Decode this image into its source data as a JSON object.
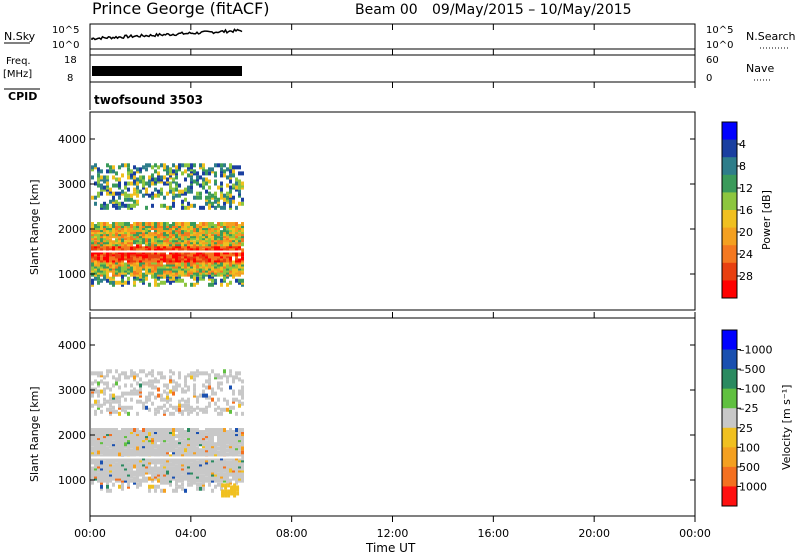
{
  "header": {
    "station": "Prince George (fitACF)",
    "beam": "Beam 00",
    "date_range": "09/May/2015 – 10/May/2015"
  },
  "nsky": {
    "label": "N.Sky",
    "tick_top": "10^5",
    "tick_bot": "10^0",
    "right_tick_top": "10^5",
    "right_tick_bot": "10^0",
    "right_label": "N.Search"
  },
  "freq": {
    "label_top": "Freq.",
    "label_bot": "[MHz]",
    "tick_top": "18",
    "tick_bot": "8",
    "right_tick_top": "60",
    "right_tick_bot": "0",
    "right_label": "Nave"
  },
  "cpid": {
    "label": "CPID",
    "value": "twofsound 3503"
  },
  "power_panel": {
    "ylabel": "Slant Range [km]",
    "yticks": [
      "1000",
      "2000",
      "3000",
      "4000"
    ],
    "colorbar_label": "Power [dB]",
    "colorbar_ticks": [
      "4",
      "8",
      "12",
      "16",
      "20",
      "24",
      "28"
    ],
    "colors": [
      "#0000ff",
      "#1a3fa0",
      "#2e7d8a",
      "#3a9a5a",
      "#8dc63f",
      "#f0c020",
      "#f4a020",
      "#f47820",
      "#e84010",
      "#ff0000"
    ]
  },
  "velocity_panel": {
    "ylabel": "Slant Range [km]",
    "yticks": [
      "1000",
      "2000",
      "3000",
      "4000"
    ],
    "colorbar_label": "Velocity [m s⁻¹]",
    "colorbar_ticks": [
      "1000",
      "500",
      "100",
      "25",
      "–25",
      "–100",
      "–500",
      "–1000"
    ],
    "colors": [
      "#0000ff",
      "#1a50b0",
      "#2a8a60",
      "#60c040",
      "#c8c8c8",
      "#f0c020",
      "#f4a020",
      "#f47020",
      "#ff1010"
    ]
  },
  "xaxis": {
    "label": "Time UT",
    "ticks": [
      "00:00",
      "04:00",
      "08:00",
      "12:00",
      "16:00",
      "20:00",
      "00:00"
    ]
  },
  "chart_data": [
    {
      "type": "heatmap",
      "title": "Power [dB]",
      "xlabel": "Time UT",
      "ylabel": "Slant Range [km]",
      "xlim": [
        "00:00",
        "24:00"
      ],
      "ylim": [
        200,
        4600
      ],
      "data_extent_x": [
        "00:00",
        "06:00"
      ],
      "features": [
        {
          "range_km": [
            1500,
            1500
          ],
          "note": "strongest echoes ~24-28 dB"
        },
        {
          "range_km": [
            1000,
            2200
          ],
          "power_db": [
            12,
            28
          ]
        },
        {
          "range_km": [
            2500,
            3500
          ],
          "power_db": [
            8,
            20
          ]
        }
      ]
    },
    {
      "type": "heatmap",
      "title": "Velocity [m s⁻¹]",
      "xlabel": "Time UT",
      "ylabel": "Slant Range [km]",
      "xlim": [
        "00:00",
        "24:00"
      ],
      "ylim": [
        200,
        4600
      ],
      "data_extent_x": [
        "00:00",
        "06:00"
      ],
      "features": [
        {
          "range_km": [
            1000,
            2200
          ],
          "velocity_ms": [
            -25,
            25
          ]
        },
        {
          "range_km": [
            700,
            900
          ],
          "time": [
            "05:00",
            "06:00"
          ],
          "velocity_ms": [
            -100,
            -25
          ]
        }
      ]
    }
  ]
}
